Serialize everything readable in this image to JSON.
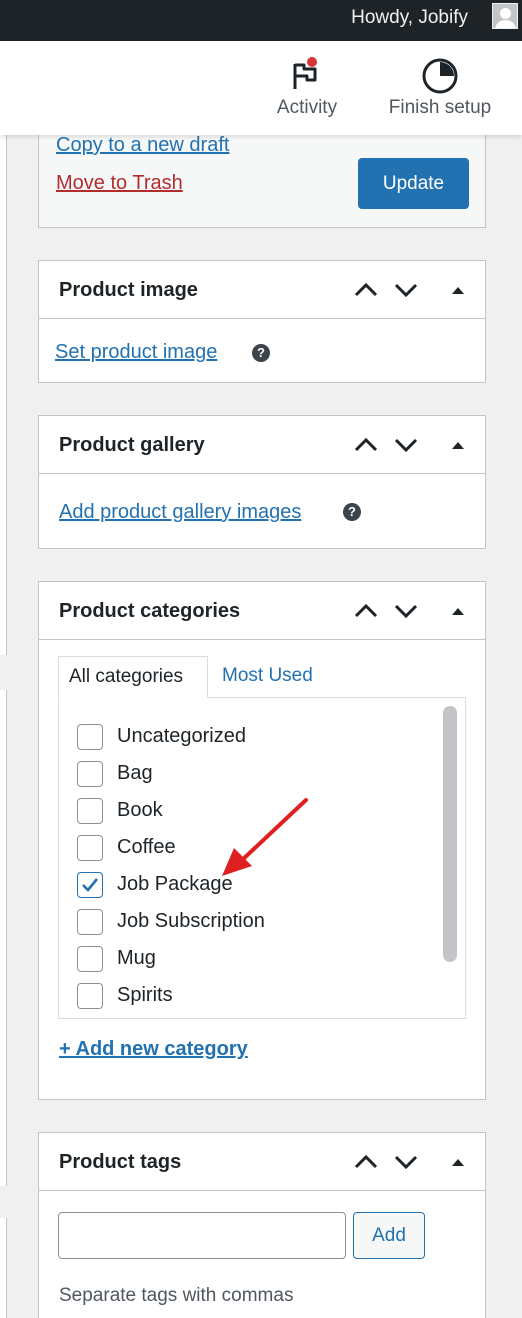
{
  "admin_bar": {
    "greeting": "Howdy, Jobify"
  },
  "activity_bar": {
    "activity_label": "Activity",
    "finish_label": "Finish setup",
    "notification_color": "#d63638"
  },
  "publish": {
    "copy_draft": "Copy to a new draft",
    "trash": "Move to Trash",
    "update_label": "Update"
  },
  "product_image": {
    "title": "Product image",
    "set_link": "Set product image",
    "help": "?"
  },
  "product_gallery": {
    "title": "Product gallery",
    "add_link": "Add product gallery images",
    "help": "?"
  },
  "product_categories": {
    "title": "Product categories",
    "tabs": [
      {
        "label": "All categories",
        "active": true
      },
      {
        "label": "Most Used",
        "active": false
      }
    ],
    "items": [
      {
        "label": "Uncategorized",
        "checked": false
      },
      {
        "label": "Bag",
        "checked": false
      },
      {
        "label": "Book",
        "checked": false
      },
      {
        "label": "Coffee",
        "checked": false
      },
      {
        "label": "Job Package",
        "checked": true
      },
      {
        "label": "Job Subscription",
        "checked": false
      },
      {
        "label": "Mug",
        "checked": false
      },
      {
        "label": "Spirits",
        "checked": false
      }
    ],
    "add_new": "+ Add new category",
    "annotation_arrow_color": "#e02020"
  },
  "product_tags": {
    "title": "Product tags",
    "input_value": "",
    "add_label": "Add",
    "hint": "Separate tags with commas"
  },
  "colors": {
    "accent": "#2271b1",
    "danger": "#b32d2e",
    "adminbar": "#1d2327"
  }
}
